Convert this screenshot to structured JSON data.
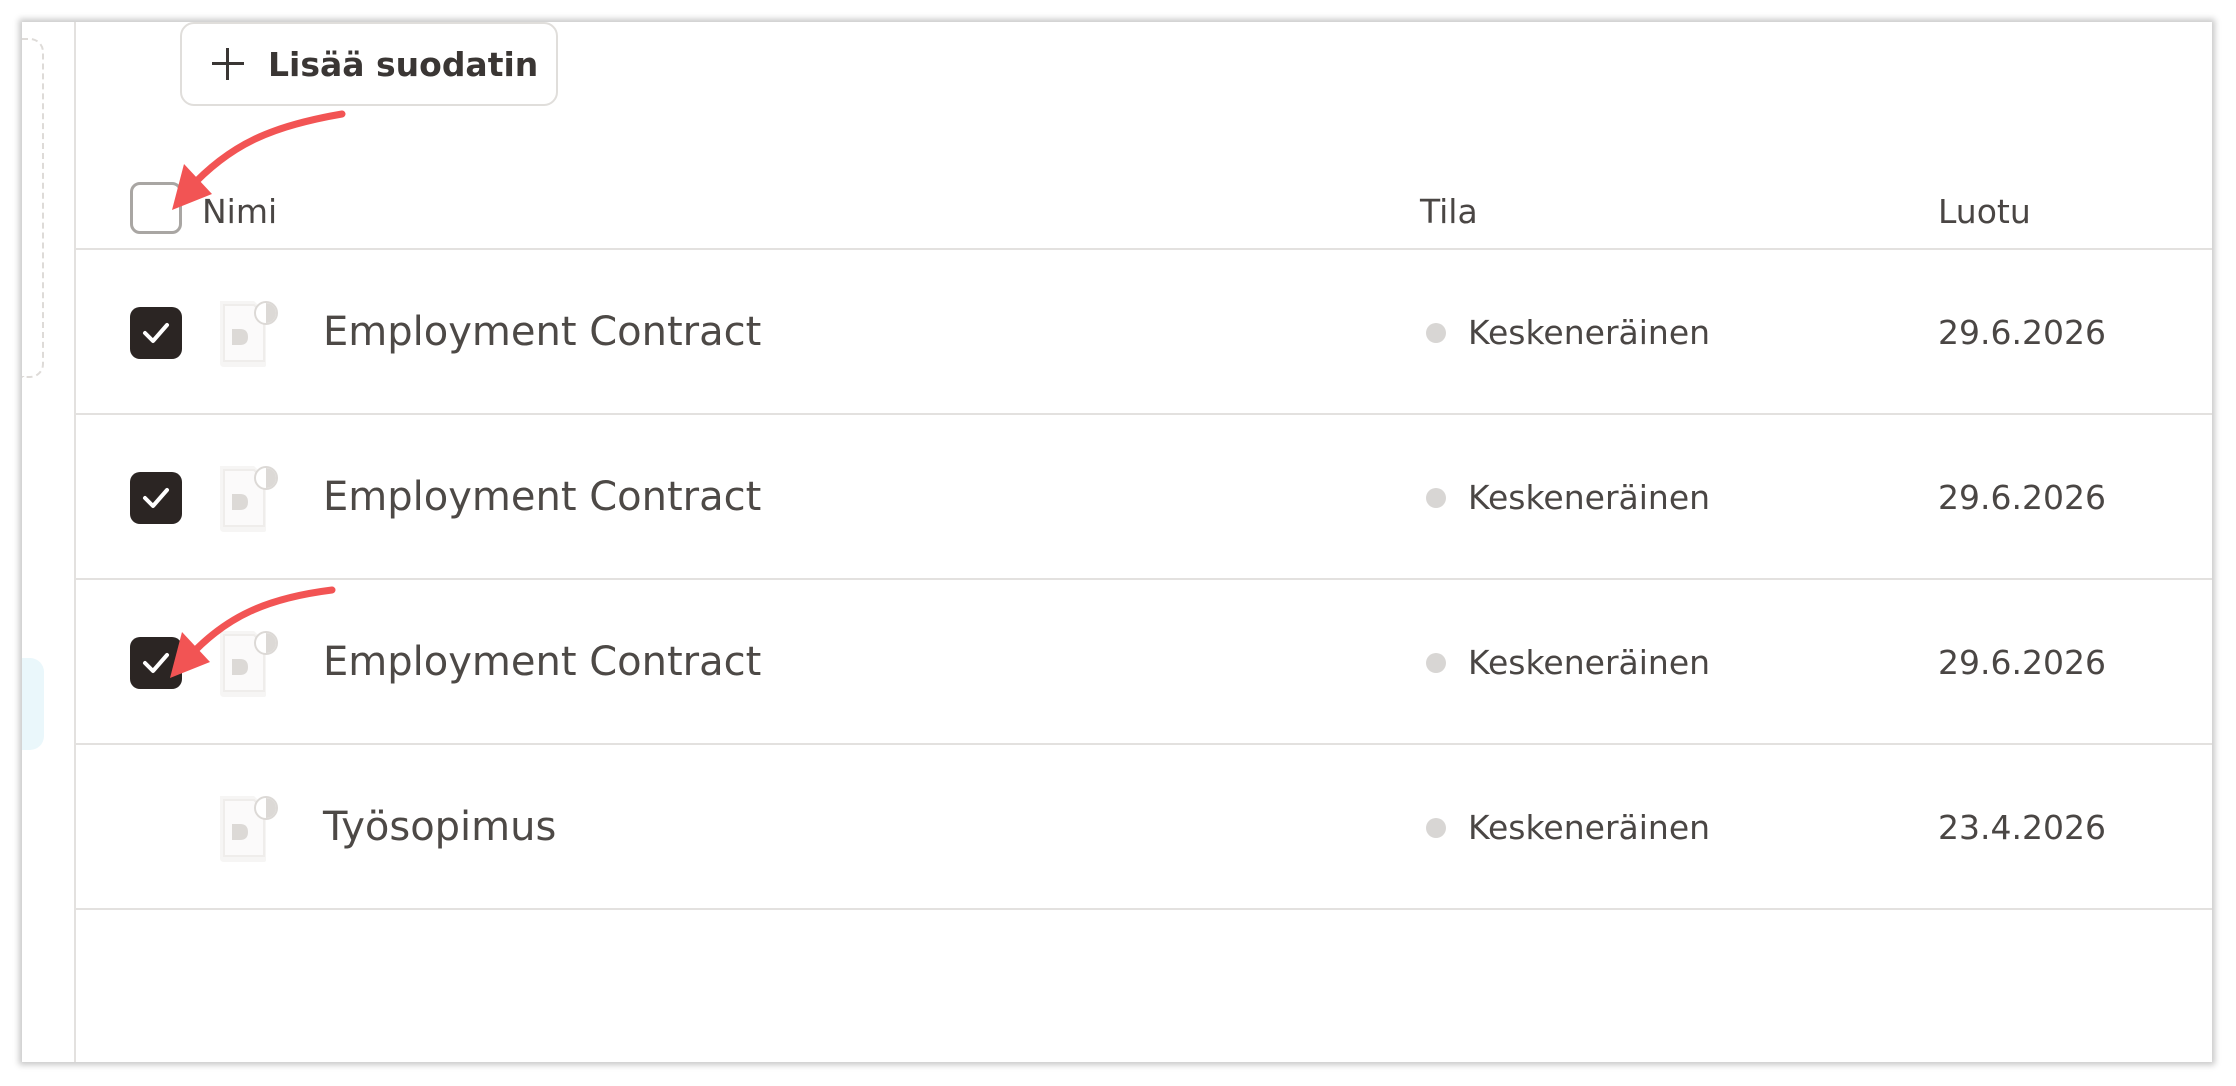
{
  "toolbar": {
    "add_filter_label": "Lisää suodatin"
  },
  "table": {
    "columns": {
      "name": "Nimi",
      "status": "Tila",
      "created": "Luotu"
    },
    "header_checkbox_checked": false,
    "rows": [
      {
        "name": "Employment Contract",
        "status": "Keskeneräinen",
        "created": "29.6.2026",
        "checked": true
      },
      {
        "name": "Employment Contract",
        "status": "Keskeneräinen",
        "created": "29.6.2026",
        "checked": true
      },
      {
        "name": "Employment Contract",
        "status": "Keskeneräinen",
        "created": "29.6.2026",
        "checked": true
      },
      {
        "name": "Työsopimus",
        "status": "Keskeneräinen",
        "created": "23.4.2026",
        "checked": false
      }
    ]
  },
  "colors": {
    "accent_arrow": "#f25454",
    "checkbox_checked": "#2b2523",
    "status_dot": "#d8d6d4"
  },
  "annotations": [
    "arrow-to-header-checkbox",
    "arrow-to-row-3-checkbox"
  ]
}
